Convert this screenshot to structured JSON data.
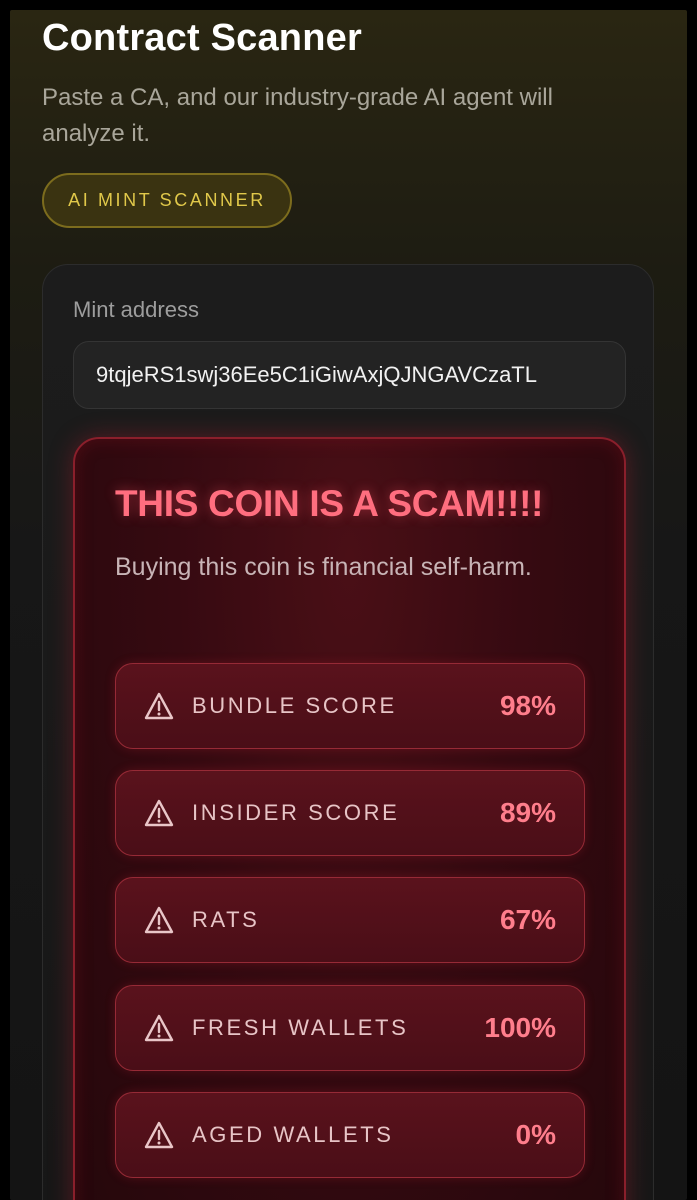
{
  "header": {
    "title": "Contract Scanner",
    "subtitle": "Paste a CA, and our industry-grade AI agent will analyze it.",
    "badge": "AI MINT SCANNER"
  },
  "form": {
    "mint_label": "Mint address",
    "mint_value": "9tqjeRS1swj36Ee5C1iGiwAxjQJNGAVCzaTL"
  },
  "result": {
    "title": "THIS COIN IS A SCAM!!!!",
    "description": "Buying this coin is financial self-harm.",
    "scores": [
      {
        "label": "BUNDLE SCORE",
        "value": "98%",
        "icon": "warning-icon"
      },
      {
        "label": "INSIDER SCORE",
        "value": "89%",
        "icon": "warning-icon"
      },
      {
        "label": "RATS",
        "value": "67%",
        "icon": "warning-icon"
      },
      {
        "label": "FRESH WALLETS",
        "value": "100%",
        "icon": "warning-icon"
      },
      {
        "label": "AGED WALLETS",
        "value": "0%",
        "icon": "warning-icon"
      }
    ]
  },
  "colors": {
    "accent_gold": "#e0c84a",
    "danger": "#ff6e7f",
    "background": "#141414"
  }
}
